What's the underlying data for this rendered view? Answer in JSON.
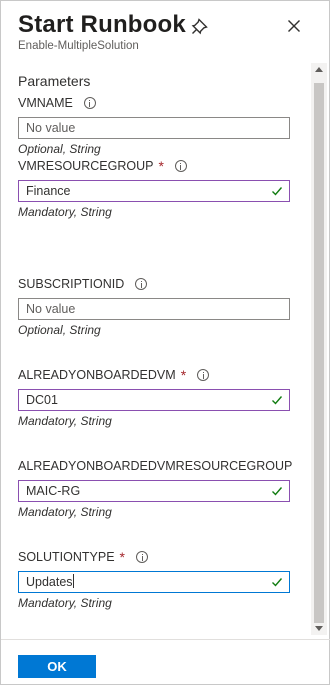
{
  "header": {
    "title": "Start Runbook",
    "subtitle": "Enable-MultipleSolution"
  },
  "parameters": {
    "section_title": "Parameters",
    "items": [
      {
        "name": "VMNAME",
        "required": false,
        "value": "",
        "placeholder": "No value",
        "hint": "Optional, String",
        "valid": false
      },
      {
        "name": "VMRESOURCEGROUP",
        "required": true,
        "value": "Finance",
        "placeholder": "",
        "hint": "Mandatory, String",
        "valid": true
      },
      {
        "name": "SUBSCRIPTIONID",
        "required": false,
        "value": "",
        "placeholder": "No value",
        "hint": "Optional, String",
        "valid": false
      },
      {
        "name": "ALREADYONBOARDEDVM",
        "required": true,
        "value": "DC01",
        "placeholder": "",
        "hint": "Mandatory, String",
        "valid": true
      },
      {
        "name": "ALREADYONBOARDEDVMRESOURCEGROUP",
        "required": true,
        "value": "MAIC-RG",
        "placeholder": "",
        "hint": "Mandatory, String",
        "valid": true
      },
      {
        "name": "SOLUTIONTYPE",
        "required": true,
        "value": "Updates",
        "placeholder": "",
        "hint": "Mandatory, String",
        "valid": true
      }
    ],
    "required_marker": "*"
  },
  "footer": {
    "ok_label": "OK"
  },
  "colors": {
    "accent": "#0078d4",
    "required": "#a4262c",
    "valid_check": "#107c10",
    "valid_border": "#8a4fb0"
  },
  "icons": {
    "pin": "pin-icon",
    "close": "close-icon",
    "info": "info-icon",
    "check": "checkmark-icon"
  }
}
